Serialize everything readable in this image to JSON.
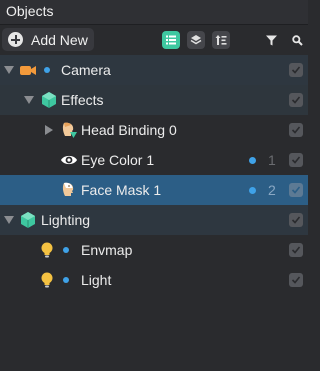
{
  "panel": {
    "title": "Objects"
  },
  "toolbar": {
    "add_label": "Add New",
    "buttons": [
      {
        "name": "list-view-icon",
        "active": true
      },
      {
        "name": "layers-view-icon",
        "active": false
      },
      {
        "name": "sort-icon",
        "active": false
      },
      {
        "name": "filter-icon",
        "active": false
      },
      {
        "name": "search-icon",
        "active": false
      }
    ]
  },
  "tree": [
    {
      "label": "Camera",
      "expanded": true,
      "icon": "camera-icon",
      "checked": true
    },
    {
      "label": "Effects",
      "expanded": true,
      "icon": "effects-icon",
      "checked": true
    },
    {
      "label": "Head Binding 0",
      "expanded": false,
      "icon": "head-binding-icon",
      "checked": true
    },
    {
      "label": "Eye Color 1",
      "icon": "eye-icon",
      "layer": "1",
      "checked": true
    },
    {
      "label": "Face Mask 1",
      "icon": "face-mask-icon",
      "layer": "2",
      "checked": true,
      "selected": true
    },
    {
      "label": "Lighting",
      "expanded": true,
      "icon": "lighting-icon",
      "checked": true
    },
    {
      "label": "Envmap",
      "icon": "bulb-icon",
      "checked": true
    },
    {
      "label": "Light",
      "icon": "bulb-icon",
      "checked": true
    }
  ]
}
